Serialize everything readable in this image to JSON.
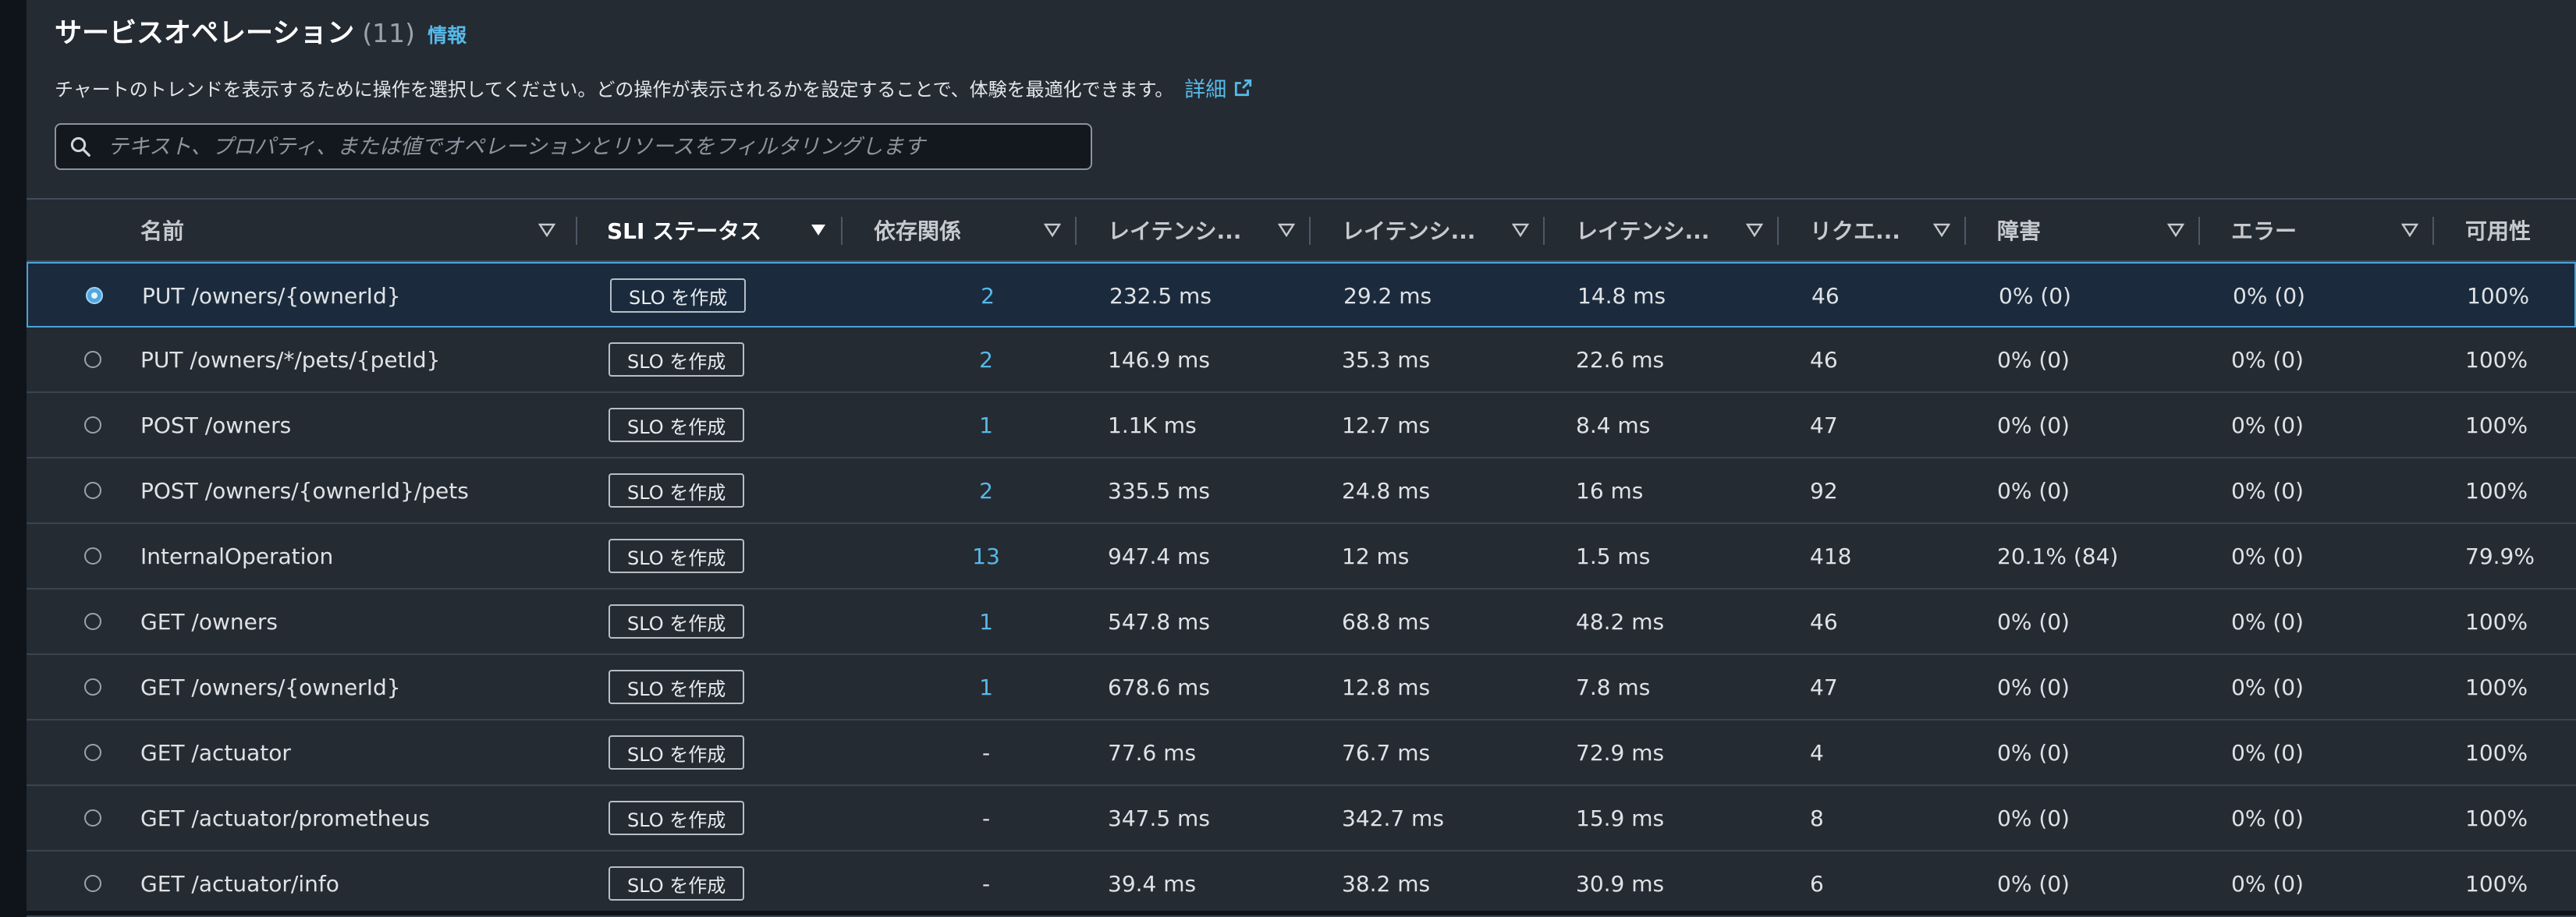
{
  "header": {
    "title": "サービスオペレーション",
    "count": "(11)",
    "info_link": "情報",
    "description": "チャートのトレンドを表示するために操作を選択してください。どの操作が表示されるかを設定することで、体験を最適化できます。",
    "detail_link": "詳細"
  },
  "search": {
    "placeholder": "テキスト、プロパティ、または値でオペレーションとリソースをフィルタリングします"
  },
  "table": {
    "columns": [
      {
        "label": "名前"
      },
      {
        "label": "SLI ステータス"
      },
      {
        "label": "依存関係"
      },
      {
        "label": "レイテンシ..."
      },
      {
        "label": "レイテンシ..."
      },
      {
        "label": "レイテンシ..."
      },
      {
        "label": "リクエ..."
      },
      {
        "label": "障害"
      },
      {
        "label": "エラー"
      },
      {
        "label": "可用性"
      }
    ],
    "slo_button_label": "SLO を作成",
    "rows": [
      {
        "name": "PUT /owners/{ownerId}",
        "deps": "2",
        "lat1": "232.5 ms",
        "lat2": "29.2 ms",
        "lat3": "14.8 ms",
        "requests": "46",
        "faults": "0% (0)",
        "errors": "0% (0)",
        "availability": "100%",
        "selected": true
      },
      {
        "name": "PUT /owners/*/pets/{petId}",
        "deps": "2",
        "lat1": "146.9 ms",
        "lat2": "35.3 ms",
        "lat3": "22.6 ms",
        "requests": "46",
        "faults": "0% (0)",
        "errors": "0% (0)",
        "availability": "100%"
      },
      {
        "name": "POST /owners",
        "deps": "1",
        "lat1": "1.1K ms",
        "lat2": "12.7 ms",
        "lat3": "8.4 ms",
        "requests": "47",
        "faults": "0% (0)",
        "errors": "0% (0)",
        "availability": "100%"
      },
      {
        "name": "POST /owners/{ownerId}/pets",
        "deps": "2",
        "lat1": "335.5 ms",
        "lat2": "24.8 ms",
        "lat3": "16 ms",
        "requests": "92",
        "faults": "0% (0)",
        "errors": "0% (0)",
        "availability": "100%"
      },
      {
        "name": "InternalOperation",
        "deps": "13",
        "lat1": "947.4 ms",
        "lat2": "12 ms",
        "lat3": "1.5 ms",
        "requests": "418",
        "faults": "20.1% (84)",
        "errors": "0% (0)",
        "availability": "79.9%"
      },
      {
        "name": "GET /owners",
        "deps": "1",
        "lat1": "547.8 ms",
        "lat2": "68.8 ms",
        "lat3": "48.2 ms",
        "requests": "46",
        "faults": "0% (0)",
        "errors": "0% (0)",
        "availability": "100%"
      },
      {
        "name": "GET /owners/{ownerId}",
        "deps": "1",
        "lat1": "678.6 ms",
        "lat2": "12.8 ms",
        "lat3": "7.8 ms",
        "requests": "47",
        "faults": "0% (0)",
        "errors": "0% (0)",
        "availability": "100%"
      },
      {
        "name": "GET /actuator",
        "deps": "-",
        "lat1": "77.6 ms",
        "lat2": "76.7 ms",
        "lat3": "72.9 ms",
        "requests": "4",
        "faults": "0% (0)",
        "errors": "0% (0)",
        "availability": "100%"
      },
      {
        "name": "GET /actuator/prometheus",
        "deps": "-",
        "lat1": "347.5 ms",
        "lat2": "342.7 ms",
        "lat3": "15.9 ms",
        "requests": "8",
        "faults": "0% (0)",
        "errors": "0% (0)",
        "availability": "100%"
      },
      {
        "name": "GET /actuator/info",
        "deps": "-",
        "lat1": "39.4 ms",
        "lat2": "38.2 ms",
        "lat3": "30.9 ms",
        "requests": "6",
        "faults": "0% (0)",
        "errors": "0% (0)",
        "availability": "100%"
      }
    ]
  },
  "colors": {
    "accent_link": "#57b9e8",
    "selected_row_border": "#4aa3d8",
    "panel_bg": "#252b33"
  }
}
